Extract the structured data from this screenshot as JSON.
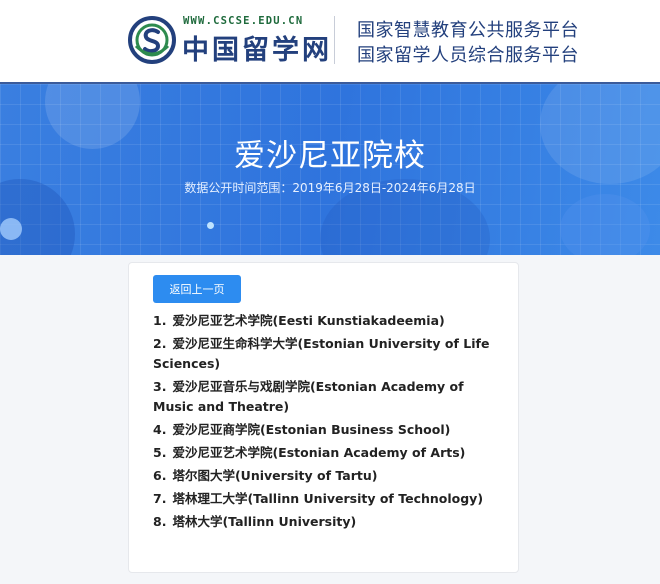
{
  "header": {
    "logo_url": "WWW.CSCSE.EDU.CN",
    "logo_text": "中国留学网",
    "platform_line1": "国家智慧教育公共服务平台",
    "platform_line2": "国家留学人员综合服务平台"
  },
  "banner": {
    "title": "爱沙尼亚院校",
    "subtitle": "数据公开时间范围：2019年6月28日-2024年6月28日"
  },
  "main": {
    "back_label": "返回上一页",
    "schools": [
      {
        "num": "1.",
        "name": "爱沙尼亚艺术学院(Eesti Kunstiakadeemia)"
      },
      {
        "num": "2.",
        "name": "爱沙尼亚生命科学大学(Estonian University of Life Sciences)"
      },
      {
        "num": "3.",
        "name": "爱沙尼亚音乐与戏剧学院(Estonian Academy of Music and Theatre)"
      },
      {
        "num": "4.",
        "name": "爱沙尼亚商学院(Estonian Business School)"
      },
      {
        "num": "5.",
        "name": "爱沙尼亚艺术学院(Estonian Academy of Arts)"
      },
      {
        "num": "6.",
        "name": "塔尔图大学(University of Tartu)"
      },
      {
        "num": "7.",
        "name": "塔林理工大学(Tallinn University of Technology)"
      },
      {
        "num": "8.",
        "name": "塔林大学(Tallinn University)"
      }
    ]
  },
  "colors": {
    "brand_navy": "#23407d",
    "brand_green": "#1e6a3c",
    "banner_blue": "#2f74dd",
    "button_blue": "#2d8cf0"
  },
  "icons": {
    "logo": "cscse-logo-icon"
  }
}
